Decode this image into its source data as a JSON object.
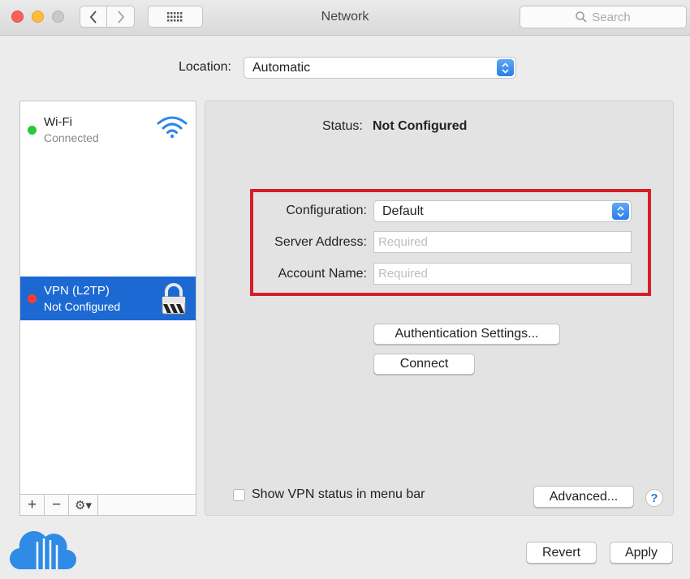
{
  "window": {
    "title": "Network"
  },
  "toolbar": {
    "search_placeholder": "Search"
  },
  "location": {
    "label": "Location:",
    "value": "Automatic"
  },
  "services": [
    {
      "name": "Wi-Fi",
      "status": "Connected",
      "icon": "wifi-icon",
      "dot_color": "#28c840"
    },
    {
      "name": "VPN (L2TP)",
      "status": "Not Configured",
      "icon": "lock-icon",
      "dot_color": "#ff3b30"
    }
  ],
  "sidebar_tools": {
    "add": "+",
    "remove": "−",
    "gear": "⚙▾"
  },
  "detail": {
    "status_label": "Status:",
    "status_value": "Not Configured",
    "configuration_label": "Configuration:",
    "configuration_value": "Default",
    "server_address_label": "Server Address:",
    "server_address_placeholder": "Required",
    "account_name_label": "Account Name:",
    "account_name_placeholder": "Required",
    "auth_settings_button": "Authentication Settings...",
    "connect_button": "Connect",
    "show_vpn_status_label": "Show VPN status in menu bar",
    "show_vpn_status_checked": false,
    "advanced_button": "Advanced...",
    "help_button": "?"
  },
  "footer": {
    "revert_button": "Revert",
    "apply_button": "Apply"
  },
  "colors": {
    "accent": "#1c69d3",
    "highlight_border": "#d61e26"
  }
}
